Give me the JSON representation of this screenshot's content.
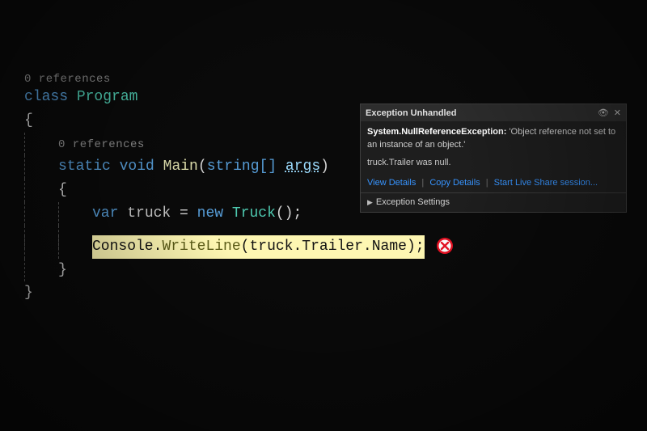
{
  "code": {
    "codelens1": "0 references",
    "line1_class_kw": "class",
    "line1_class_name": "Program",
    "brace_open": "{",
    "codelens2": "0 references",
    "line2_static": "static",
    "line2_void": "void",
    "line2_main": "Main",
    "line2_paren_open": "(",
    "line2_param_type": "string[]",
    "line2_param_name": "args",
    "line2_paren_close": ")",
    "inner_brace_open": "{",
    "line3_var": "var",
    "line3_truck": "truck",
    "line3_eq": " = ",
    "line3_new": "new",
    "line3_type": "Truck",
    "line3_call": "();",
    "hl_console": "Console",
    "hl_dot1": ".",
    "hl_writeline": "WriteLine",
    "hl_paren_open": "(",
    "hl_truck": "truck",
    "hl_dot2": ".",
    "hl_trailer": "Trailer",
    "hl_dot3": ".",
    "hl_name": "Name",
    "hl_close": ");",
    "inner_brace_close": "}",
    "brace_close": "}"
  },
  "exception": {
    "title": "Exception Unhandled",
    "type": "System.NullReferenceException:",
    "message": "'Object reference not set to an instance of an object.'",
    "detail": "truck.Trailer was null.",
    "link_view": "View Details",
    "link_copy": "Copy Details",
    "link_liveshare": "Start Live Share session...",
    "settings": "Exception Settings"
  },
  "icons": {
    "pin": "📌",
    "close": "✕"
  }
}
